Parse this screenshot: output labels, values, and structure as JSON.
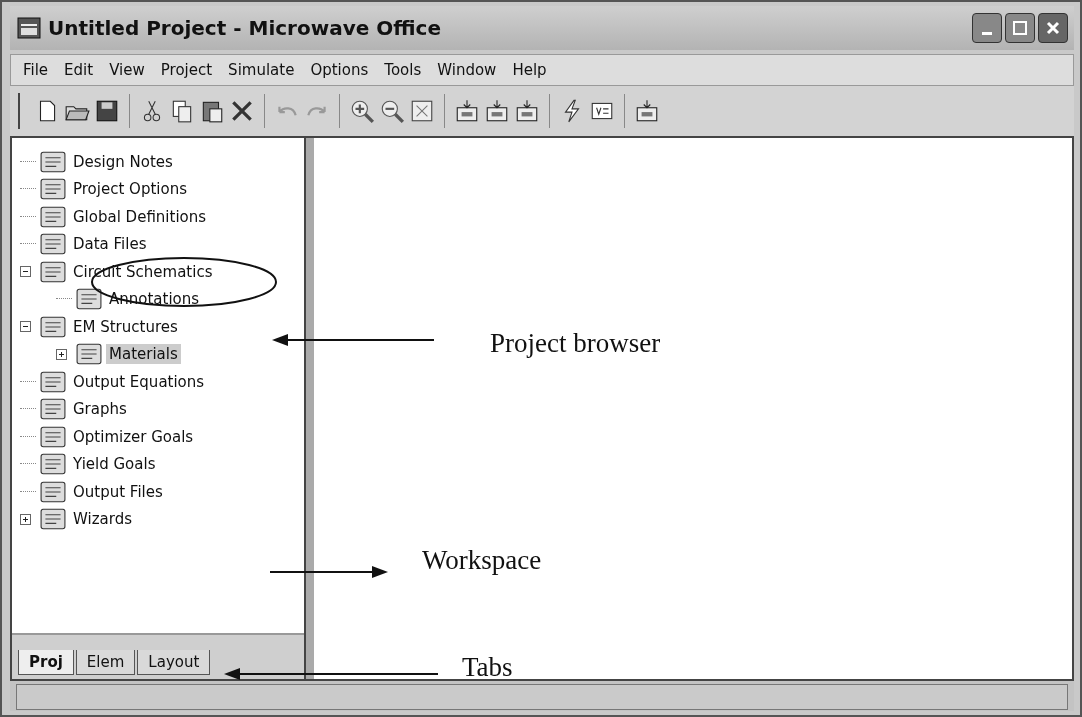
{
  "window": {
    "title": "Untitled Project - Microwave Office"
  },
  "menu": [
    "File",
    "Edit",
    "View",
    "Project",
    "Simulate",
    "Options",
    "Tools",
    "Window",
    "Help"
  ],
  "project_tree": [
    {
      "label": "Design Notes",
      "selected": false
    },
    {
      "label": "Project Options",
      "selected": false
    },
    {
      "label": "Global Definitions",
      "selected": false
    },
    {
      "label": "Data Files",
      "selected": false
    },
    {
      "label": "Circuit Schematics",
      "selected": false,
      "expanded": true,
      "children": [
        {
          "label": "Annotations",
          "selected": false
        }
      ]
    },
    {
      "label": "EM Structures",
      "selected": false,
      "expanded": true,
      "children": [
        {
          "label": "Materials",
          "selected": true,
          "expanded": false
        }
      ]
    },
    {
      "label": "Output Equations",
      "selected": false
    },
    {
      "label": "Graphs",
      "selected": false
    },
    {
      "label": "Optimizer Goals",
      "selected": false
    },
    {
      "label": "Yield Goals",
      "selected": false
    },
    {
      "label": "Output Files",
      "selected": false
    },
    {
      "label": "Wizards",
      "selected": false,
      "expanded": false
    }
  ],
  "tabs": [
    {
      "label": "Proj",
      "selected": true
    },
    {
      "label": "Elem",
      "selected": false
    },
    {
      "label": "Layout",
      "selected": false
    }
  ],
  "annotations": [
    {
      "label": "Project browser"
    },
    {
      "label": "Workspace"
    },
    {
      "label": "Tabs"
    }
  ]
}
